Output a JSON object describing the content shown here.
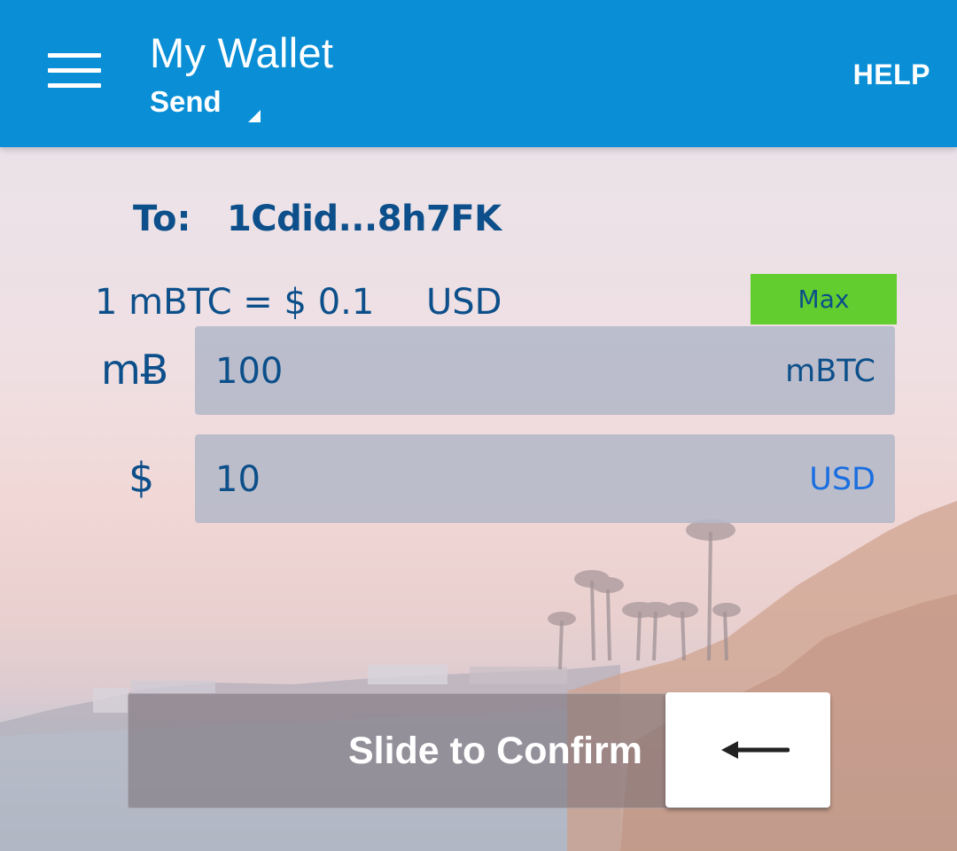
{
  "header": {
    "menu_icon": "hamburger-menu-icon",
    "title": "My Wallet",
    "mode": "Send",
    "help_label": "HELP"
  },
  "send": {
    "to_label": "To:",
    "to_address": "1Cdid...8h7FK",
    "rate_text": "1 mBTC = $ 0.1",
    "rate_currency": "USD",
    "max_label": "Max",
    "btc_row": {
      "symbol": "mɃ",
      "value": "100",
      "unit": "mBTC"
    },
    "usd_row": {
      "symbol": "$",
      "value": "10",
      "unit": "USD"
    }
  },
  "slider": {
    "label": "Slide to Confirm",
    "handle_icon": "arrow-left-icon"
  },
  "colors": {
    "appbar": "#0a8fd6",
    "text_primary": "#0c4f8a",
    "max_button": "#62cd2e",
    "usd_unit": "#1a6fe0"
  }
}
